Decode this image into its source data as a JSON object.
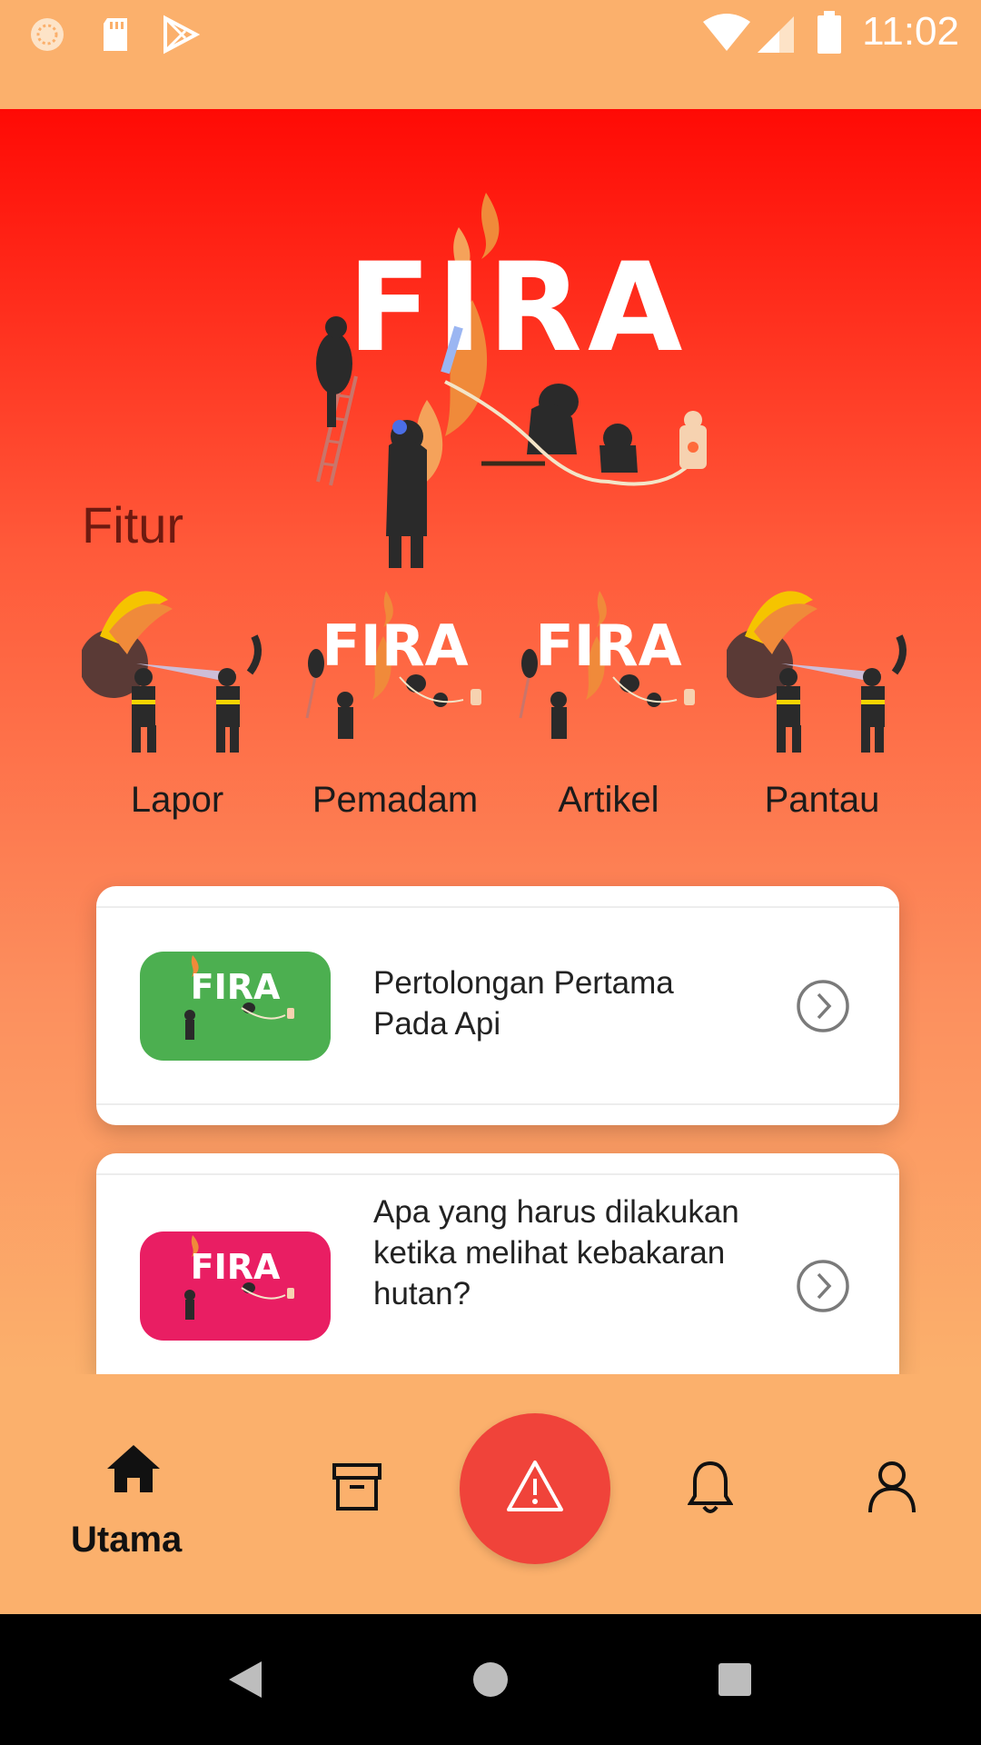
{
  "status_bar": {
    "time": "11:02",
    "icons": [
      "sync-icon",
      "sd-card-icon",
      "play-store-icon",
      "wifi-icon",
      "signal-icon",
      "battery-icon"
    ]
  },
  "hero": {
    "logo_text": "FIRA"
  },
  "features": {
    "title": "Fitur",
    "items": [
      {
        "label": "Lapor",
        "icon": "firefighters-illustration"
      },
      {
        "label": "Pemadam",
        "icon": "fira-logo-illustration",
        "art_text": "FIRA"
      },
      {
        "label": "Artikel",
        "icon": "fira-logo-illustration",
        "art_text": "FIRA"
      },
      {
        "label": "Pantau",
        "icon": "firefighters-illustration"
      }
    ]
  },
  "articles": [
    {
      "title": "Pertolongan Pertama Pada Api",
      "thumb_text": "FIRA",
      "thumb_color": "#4CAF50"
    },
    {
      "title": "Apa yang harus dilakukan ketika melihat kebakaran hutan?",
      "thumb_text": "FIRA",
      "thumb_color": "#E91E63"
    }
  ],
  "bottom_nav": {
    "items": [
      {
        "label": "Utama",
        "icon": "home-icon",
        "active": true
      },
      {
        "label": "",
        "icon": "archive-icon"
      },
      {
        "label": "",
        "icon": "alert-icon"
      },
      {
        "label": "",
        "icon": "bell-icon"
      },
      {
        "label": "",
        "icon": "user-icon"
      }
    ]
  },
  "colors": {
    "status_bar": "#FBB06C",
    "gradient_top": "#FF0A05",
    "fab": "#F0433A",
    "section_title": "#6E1A10"
  }
}
